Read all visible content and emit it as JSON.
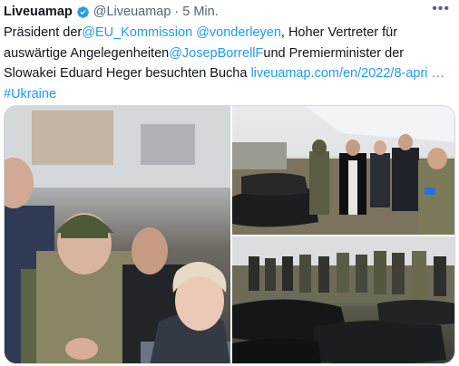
{
  "tweet": {
    "author_name": "Liveuamap",
    "handle": "@Liveuamap",
    "separator": "·",
    "time": "5 Min.",
    "more_label": "•••",
    "text": {
      "part1": "Präsident der",
      "mention1": "@EU_Kommission",
      "space1": " ",
      "mention2": "@vonderleyen",
      "part2": ", Hoher Vertreter für auswärtige Angelegenheiten",
      "mention3": "@JosepBorrellF",
      "part3": "und Premierminister der Slowakei Eduard Heger besuchten Bucha  ",
      "link": "liveuamap.com/en/2022/8-apri …",
      "space2": " ",
      "hashtag": "#Ukraine"
    }
  },
  "media": {
    "photo1_alt": "photo-officials",
    "photo2_alt": "photo-bodybags-priest",
    "photo3_alt": "photo-soldiers-bodybags"
  },
  "colors": {
    "link": "#1d9bf0",
    "verified": "#1d9bf0",
    "muted": "#536471"
  }
}
